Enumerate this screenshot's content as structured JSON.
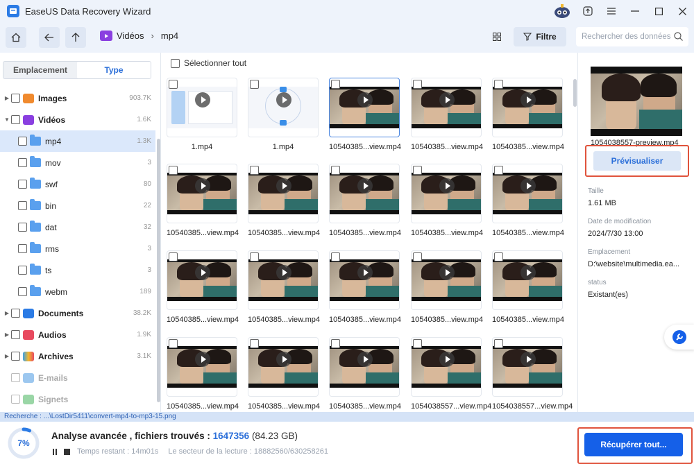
{
  "app": {
    "title": "EaseUS Data Recovery Wizard"
  },
  "toolbar": {
    "crumbs": [
      "Vidéos",
      "mp4"
    ],
    "filter_label": "Filtre",
    "search_placeholder": "Rechercher des données"
  },
  "left": {
    "tabs": [
      {
        "label": "Emplacement",
        "active": false
      },
      {
        "label": "Type",
        "active": true
      }
    ],
    "tree": [
      {
        "label": "Images",
        "count": "903.7K",
        "color": "#f08a2e"
      },
      {
        "label": "Vidéos",
        "count": "1.6K",
        "color": "#8a3fe0"
      },
      {
        "label": "mp4",
        "count": "1.3K",
        "selected": true
      },
      {
        "label": "mov",
        "count": "3"
      },
      {
        "label": "swf",
        "count": "80"
      },
      {
        "label": "bin",
        "count": "22"
      },
      {
        "label": "dat",
        "count": "32"
      },
      {
        "label": "rms",
        "count": "3"
      },
      {
        "label": "ts",
        "count": "3"
      },
      {
        "label": "webm",
        "count": "189"
      },
      {
        "label": "Documents",
        "count": "38.2K",
        "color": "#2b7be5"
      },
      {
        "label": "Audios",
        "count": "1.9K",
        "color": "#e84a5f"
      },
      {
        "label": "Archives",
        "count": "3.1K",
        "color": "#3aa0e8"
      },
      {
        "label": "E-mails",
        "count": "",
        "color": "#9cc7ef"
      },
      {
        "label": "Signets",
        "count": "",
        "color": "#9ad6a6"
      }
    ]
  },
  "main": {
    "select_all_label": "Sélectionner tout",
    "files": [
      "1.mp4",
      "1.mp4",
      "10540385...view.mp4",
      "10540385...view.mp4",
      "10540385...view.mp4",
      "10540385...view.mp4",
      "10540385...view.mp4",
      "10540385...view.mp4",
      "10540385...view.mp4",
      "10540385...view.mp4",
      "10540385...view.mp4",
      "10540385...view.mp4",
      "10540385...view.mp4",
      "10540385...view.mp4",
      "10540385...view.mp4",
      "10540385...view.mp4",
      "10540385...view.mp4",
      "10540385...view.mp4",
      "10540385...view.mp4",
      "10540385...view.mp4"
    ],
    "partial_names": [
      "10540385...view.mp4",
      "10540385...view.mp4",
      "10540385...view.mp4",
      "1054038557...view.mp4",
      "1054038557...view.mp4"
    ]
  },
  "detail": {
    "file_name": "1054038557-preview.mp4",
    "preview_label": "Prévisualiser",
    "size_label": "Taille",
    "size_value": "1.61 MB",
    "modified_label": "Date de modification",
    "modified_value": "2024/7/30 13:00",
    "location_label": "Emplacement",
    "location_value": "D:\\website\\multimedia.ea...",
    "status_label": "status",
    "status_value": "Existant(es)"
  },
  "pathbar": {
    "text": "Recherche : ...\\LostDir5411\\convert-mp4-to-mp3-15.png"
  },
  "scan": {
    "progress_percent": 7,
    "progress_label": "7%",
    "title": "Analyse avancée , fichiers trouvés : ",
    "count": "1647356",
    "size": " (84.23 GB)",
    "remaining": "Temps restant : 14m01s",
    "sector": "Le secteur de la lecture : 18882560/630258261"
  },
  "recover": {
    "label": "Récupérer tout..."
  },
  "colors": {
    "accent": "#1560e8",
    "highlight": "#e0533c"
  }
}
